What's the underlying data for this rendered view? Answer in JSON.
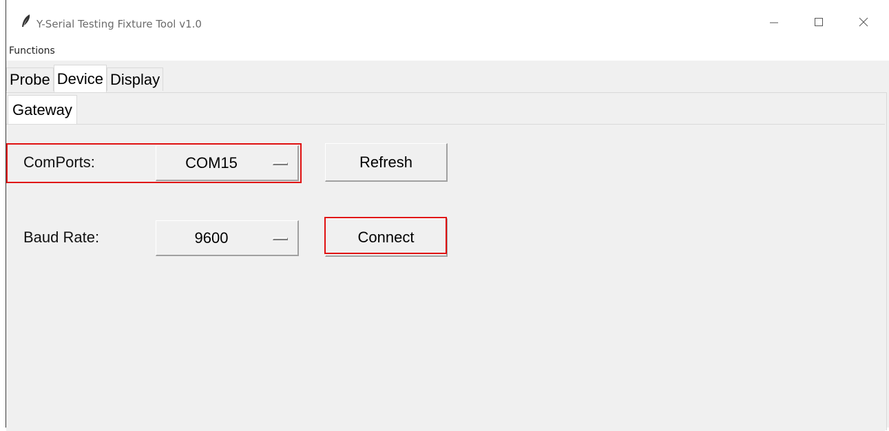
{
  "window": {
    "title": "Y-Serial Testing Fixture Tool  v1.0",
    "app_icon": "feather-icon",
    "controls": {
      "minimize": "minimize-icon",
      "maximize": "maximize-icon",
      "close": "close-icon"
    }
  },
  "menubar": {
    "items": [
      "Functions"
    ]
  },
  "tabs": {
    "items": [
      "Probe",
      "Device",
      "Display"
    ],
    "active": "Device"
  },
  "subtabs": {
    "items": [
      "Gateway"
    ],
    "active": "Gateway"
  },
  "gateway": {
    "comports_label": "ComPorts:",
    "comports_value": "COM15",
    "refresh_label": "Refresh",
    "baud_label": "Baud Rate:",
    "baud_value": "9600",
    "connect_label": "Connect"
  },
  "colors": {
    "highlight": "#e01010",
    "panel_bg": "#f0f0f0"
  }
}
